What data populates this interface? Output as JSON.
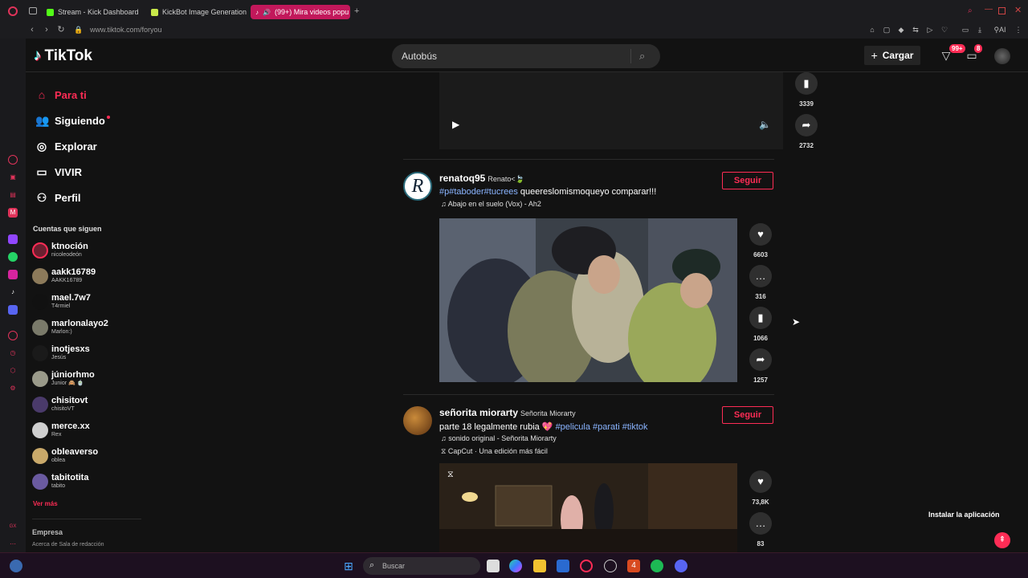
{
  "browser": {
    "tabs": [
      {
        "label": "Stream - Kick Dashboard"
      },
      {
        "label": "KickBot Image Generation"
      },
      {
        "label": "(99+) Mira videos popu"
      }
    ],
    "url": "www.tiktok.com/foryou"
  },
  "header": {
    "logo": "TikTok",
    "search_value": "Autobús",
    "upload_label": "Cargar",
    "inbox_badge": "99+",
    "messages_badge": "8"
  },
  "nav": [
    {
      "label": "Para ti",
      "icon": "home-icon"
    },
    {
      "label": "Siguiendo",
      "icon": "following-icon"
    },
    {
      "label": "Explorar",
      "icon": "compass-icon"
    },
    {
      "label": "VIVIR",
      "icon": "live-icon"
    },
    {
      "label": "Perfil",
      "icon": "person-icon"
    }
  ],
  "following": {
    "title": "Cuentas que siguen",
    "accounts": [
      {
        "name": "ktnoción",
        "sub": "nicoleodeón"
      },
      {
        "name": "aakk16789",
        "sub": "AAKK16789"
      },
      {
        "name": "mael.7w7",
        "sub": "T4rmiel"
      },
      {
        "name": "marlonalayo2",
        "sub": "Marlon:)"
      },
      {
        "name": "inotjesxs",
        "sub": "Jesús"
      },
      {
        "name": "júniorhmo",
        "sub": "Junior 🙈 🍵"
      },
      {
        "name": "chisitovt",
        "sub": "chisitoVT"
      },
      {
        "name": "merce.xx",
        "sub": "Rex"
      },
      {
        "name": "obleaverso",
        "sub": "oblea"
      },
      {
        "name": "tabitotita",
        "sub": "tabito"
      }
    ],
    "see_more": "Ver más"
  },
  "footer": {
    "title": "Empresa",
    "links": "Acerca de  Sala de redacción"
  },
  "top_post": {
    "save_count": "3339",
    "share_count": "2732"
  },
  "posts": [
    {
      "username": "renatoq95",
      "nickname": "Renato<🍃",
      "tags": "#p#taboder#tucrees",
      "text": " queereslomismoqueyo comparar!!!",
      "music": "♫ Abajo en el suelo (Vox) - Ah2",
      "follow": "Seguir",
      "likes": "6603",
      "comments": "316",
      "saves": "1066",
      "shares": "1257"
    },
    {
      "username": "señorita miorarty",
      "nickname": "Señorita Miorarty",
      "text": "parte 18 legalmente rubia 💖 ",
      "tags": "#pelicula #parati #tiktok",
      "music": "♫ sonido original - Señorita Miorarty",
      "capcut": "CapCut · Una edición más fácil",
      "follow": "Seguir",
      "likes": "73,8K",
      "comments": "83"
    }
  ],
  "install_label": "Instalar la aplicación",
  "taskbar": {
    "search_placeholder": "Buscar"
  },
  "colors": {
    "accent": "#fe2c55",
    "background": "#121212",
    "tag": "#8ab4ff"
  }
}
